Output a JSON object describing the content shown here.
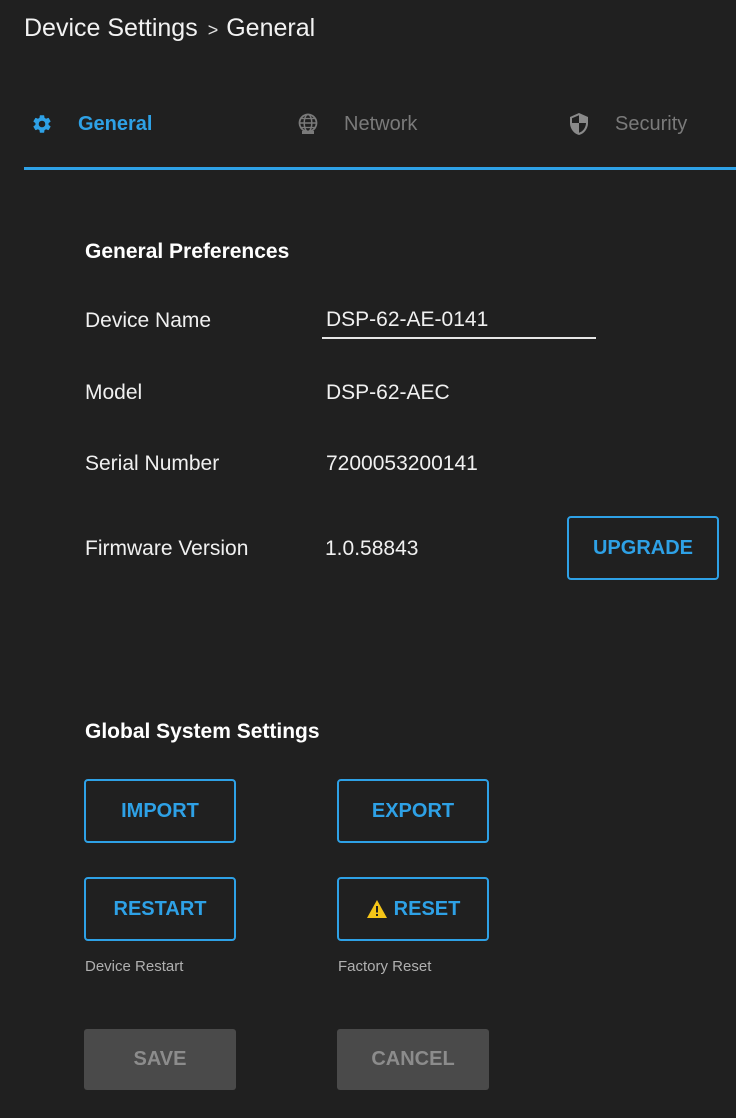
{
  "header": {
    "breadcrumb_root": "Device Settings",
    "breadcrumb_separator": ">",
    "breadcrumb_current": "General"
  },
  "tabs": [
    {
      "label": "General",
      "icon": "gear-icon",
      "active": true
    },
    {
      "label": "Network",
      "icon": "globe-network-icon",
      "active": false
    },
    {
      "label": "Security",
      "icon": "shield-icon",
      "active": false
    }
  ],
  "general_preferences": {
    "title": "General Preferences",
    "device_name_label": "Device Name",
    "device_name_value": "DSP-62-AE-0141",
    "model_label": "Model",
    "model_value": "DSP-62-AEC",
    "serial_label": "Serial Number",
    "serial_value": "7200053200141",
    "firmware_label": "Firmware Version",
    "firmware_value": "1.0.58843",
    "upgrade_label": "UPGRADE"
  },
  "global_system": {
    "title": "Global System Settings",
    "import_label": "IMPORT",
    "export_label": "EXPORT",
    "restart_label": "RESTART",
    "restart_caption": "Device Restart",
    "reset_label": "RESET",
    "reset_icon": "warning-icon",
    "reset_caption": "Factory Reset"
  },
  "footer": {
    "save_label": "SAVE",
    "cancel_label": "CANCEL"
  },
  "colors": {
    "background": "#202020",
    "accent": "#2ea1e6",
    "inactive_tab": "#7a7a7a",
    "warning": "#f5c518",
    "disabled_button": "#4a4a4a"
  }
}
